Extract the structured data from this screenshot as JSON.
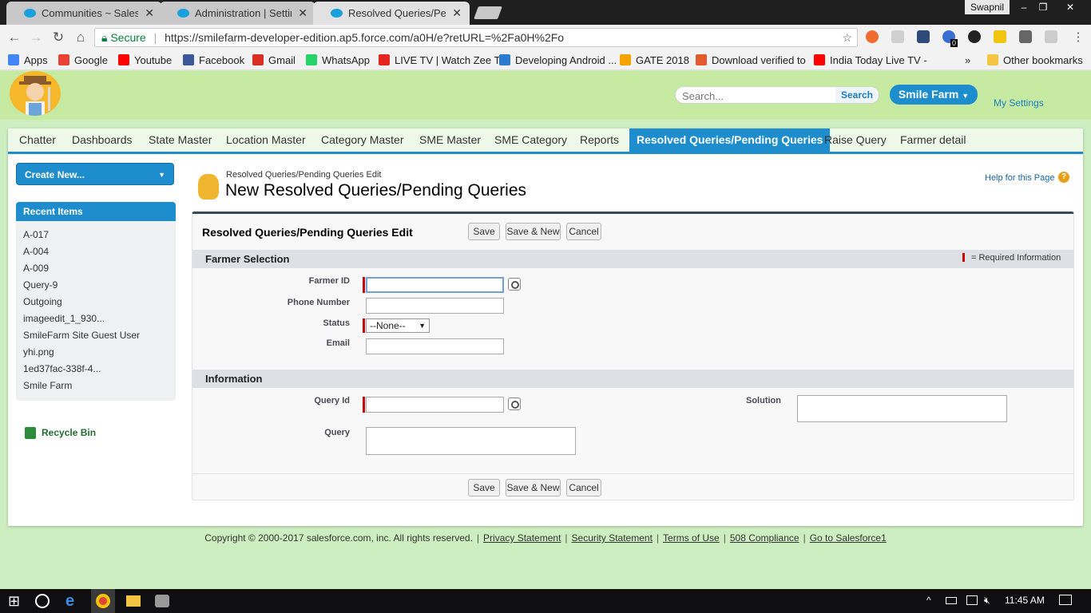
{
  "browser": {
    "tabs": [
      {
        "title": "Communities ~ Salesforce",
        "close": "✕"
      },
      {
        "title": "Administration | Settings",
        "close": "✕"
      },
      {
        "title": "Resolved Queries/Pending",
        "close": "✕"
      }
    ],
    "user": "Swapnil",
    "window_buttons": [
      "–",
      "❐",
      "✕"
    ],
    "secure_label": "Secure",
    "url": "https://smilefarm-developer-edition.ap5.force.com/a0H/e?retURL=%2Fa0H%2Fo",
    "extension_badge": "0",
    "bookmarks": [
      {
        "label": "Apps",
        "color": "#4285f4"
      },
      {
        "label": "Google",
        "color": "#ea4335"
      },
      {
        "label": "Youtube",
        "color": "#ff0000"
      },
      {
        "label": "Facebook",
        "color": "#3b5998"
      },
      {
        "label": "Gmail",
        "color": "#d93025"
      },
      {
        "label": "WhatsApp",
        "color": "#25d366"
      },
      {
        "label": "LIVE TV | Watch Zee T",
        "color": "#e52620"
      },
      {
        "label": "Developing Android ...",
        "color": "#2b7bd3"
      },
      {
        "label": "GATE 2018",
        "color": "#f4a300"
      },
      {
        "label": "Download verified to",
        "color": "#e35b2c"
      },
      {
        "label": "India Today Live TV -",
        "color": "#ff0000"
      }
    ],
    "bookmarks_more": "»",
    "other_bookmarks": "Other bookmarks"
  },
  "header": {
    "search_placeholder": "Search...",
    "search_button": "Search",
    "app_menu": "Smile Farm",
    "my_settings": "My Settings"
  },
  "nav_tabs": [
    {
      "label": "Chatter",
      "active": false
    },
    {
      "label": "Dashboards",
      "active": false
    },
    {
      "label": "State Master",
      "active": false
    },
    {
      "label": "Location Master",
      "active": false
    },
    {
      "label": "Category Master",
      "active": false
    },
    {
      "label": "SME Master",
      "active": false
    },
    {
      "label": "SME Category",
      "active": false
    },
    {
      "label": "Reports",
      "active": false
    },
    {
      "label": "Resolved Queries/Pending Queries",
      "active": true
    },
    {
      "label": "Raise Query",
      "active": false
    },
    {
      "label": "Farmer detail",
      "active": false
    }
  ],
  "sidebar": {
    "create_new": "Create New...",
    "recent_items_title": "Recent Items",
    "recent_items": [
      "A-017",
      "A-004",
      "A-009",
      "Query-9",
      "Outgoing",
      "imageedit_1_930...",
      "SmileFarm Site Guest User",
      "yhi.png",
      "1ed37fac-338f-4...",
      "Smile Farm"
    ],
    "recycle_bin": "Recycle Bin"
  },
  "page": {
    "breadcrumb": "Resolved Queries/Pending Queries Edit",
    "title": "New Resolved Queries/Pending Queries",
    "help_link": "Help for this Page",
    "help_icon": "?"
  },
  "form": {
    "block_title": "Resolved Queries/Pending Queries Edit",
    "buttons": {
      "save": "Save",
      "save_new": "Save & New",
      "cancel": "Cancel"
    },
    "required_info": "= Required Information",
    "sections": {
      "farmer_selection": {
        "title": "Farmer Selection",
        "farmer_id_label": "Farmer ID",
        "farmer_id_value": "",
        "phone_label": "Phone Number",
        "phone_value": "",
        "status_label": "Status",
        "status_value": "--None--",
        "email_label": "Email",
        "email_value": ""
      },
      "information": {
        "title": "Information",
        "query_id_label": "Query Id",
        "query_id_value": "",
        "query_label": "Query",
        "solution_label": "Solution"
      }
    }
  },
  "footer": {
    "copyright": "Copyright © 2000-2017 salesforce.com, inc. All rights reserved.",
    "links": [
      "Privacy Statement",
      "Security Statement",
      "Terms of Use",
      "508 Compliance",
      "Go to Salesforce1"
    ]
  },
  "taskbar": {
    "clock": "11:45 AM"
  }
}
